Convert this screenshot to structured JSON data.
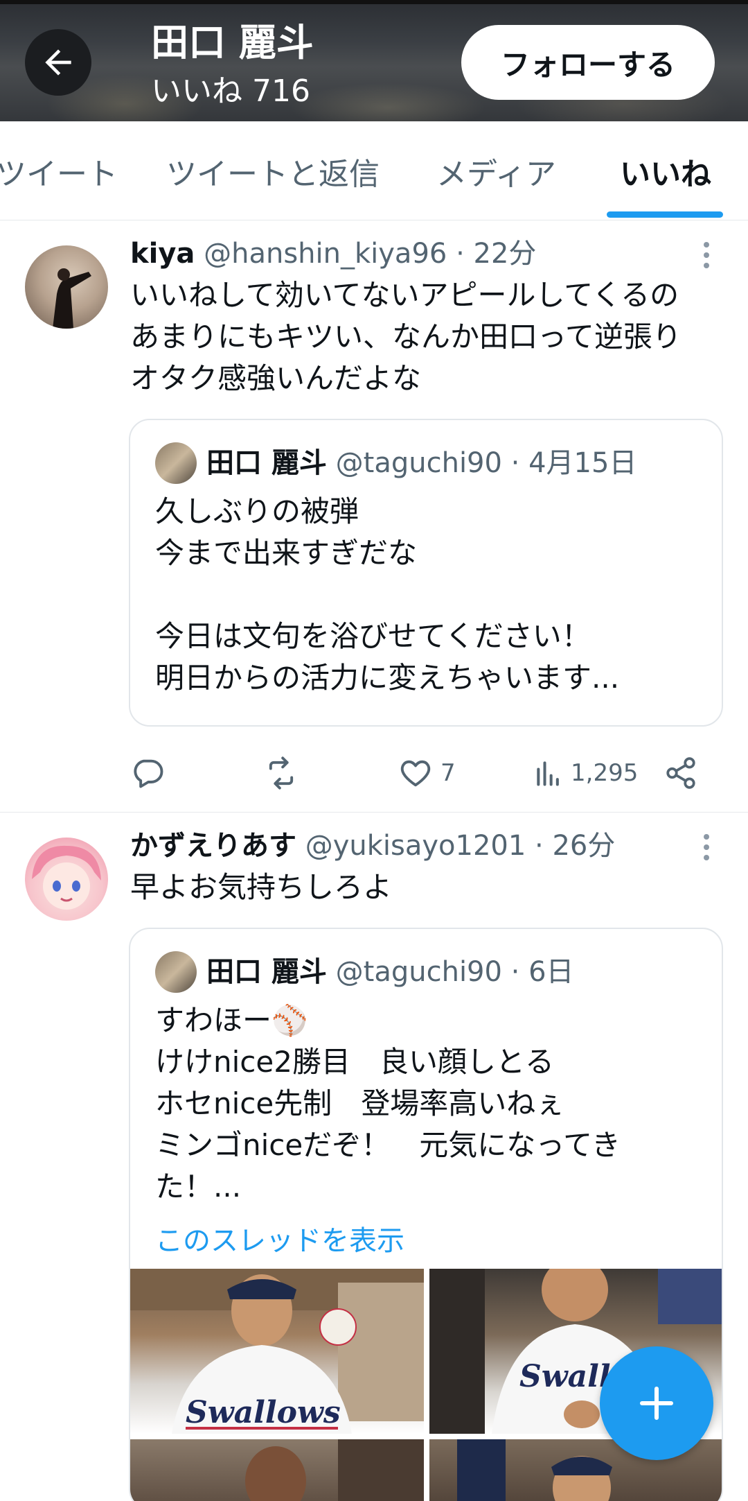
{
  "header": {
    "title": "田口 麗斗",
    "likes_count_label": "いいね 716",
    "follow_label": "フォローする"
  },
  "tabs": [
    {
      "label": "ツイート"
    },
    {
      "label": "ツイートと返信"
    },
    {
      "label": "メディア"
    },
    {
      "label": "いいね",
      "active": true
    }
  ],
  "tweets": [
    {
      "name": "kiya",
      "handle": "@hanshin_kiya96",
      "time": "· 22分",
      "text": "いいねして効いてないアピールしてくるの\nあまりにもキツい、なんか田口って逆張り\nオタク感強いんだよな",
      "quote": {
        "name": "田口 麗斗",
        "handle": "@taguchi90",
        "time": "· 4月15日",
        "text": "久しぶりの被弾\n今まで出来すぎだな\n\n今日は文句を浴びせてください！\n明日からの活力に変えちゃいます..."
      },
      "actions": {
        "reply_count": "",
        "retweet_count": "",
        "like_count": "7",
        "views_count": "1,295"
      }
    },
    {
      "name": "かずえりあす",
      "handle": "@yukisayo1201",
      "time": "· 26分",
      "text": "早よお気持ちしろよ",
      "quote": {
        "name": "田口 麗斗",
        "handle": "@taguchi90",
        "time": "· 6日",
        "text": "すわほー⚾\nけけnice2勝目　良い顔しとる\nホセnice先制　登場率高いねぇ\nミンゴniceだぞ！　元気になってき\nた！...",
        "show_thread_label": "このスレッドを表示"
      }
    }
  ],
  "fab": {
    "icon": "plus-icon"
  },
  "colors": {
    "accent": "#1d9bf0",
    "text": "#0f1419",
    "muted": "#536471"
  }
}
